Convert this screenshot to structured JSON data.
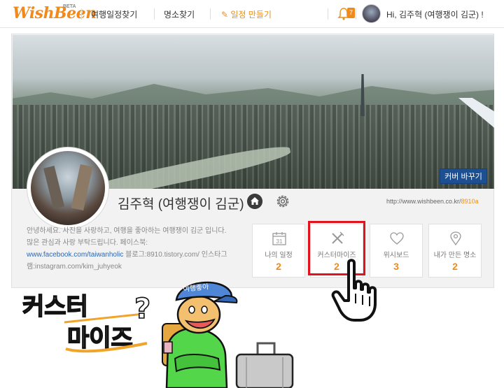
{
  "header": {
    "logo": "WishBeen",
    "beta": "BETA",
    "nav": [
      "여행일정찾기",
      "명소찾기",
      "✎ 일정 만들기"
    ],
    "notification_count": "7",
    "greeting": "Hi, 김주혁 (여행쟁이 김군) !"
  },
  "profile": {
    "cover_button": "커버 바꾸기",
    "name": "김주혁 (여행쟁이 김군)",
    "url_prefix": "http://www.wishbeen.co.kr/",
    "url_id": "8910a",
    "bio": [
      "안녕하세요. 사진을 사랑하고, 여행을 좋아하는 여행쟁이 김군 입니다.",
      "많은 관심과 사랑 부탁드립니다. 페이스북:",
      "www.facebook.com/taiwanholic",
      " 블로그:8910.tistory.com/ 인스타그",
      "램:instagram.com/kim_juhyeok"
    ]
  },
  "stats": [
    {
      "label": "나의 일정",
      "count": "2",
      "icon": "calendar-icon",
      "day": "31"
    },
    {
      "label": "커스터마이즈",
      "count": "2",
      "icon": "pencil-ruler-icon"
    },
    {
      "label": "위시보드",
      "count": "3",
      "icon": "heart-icon"
    },
    {
      "label": "내가 만든 명소",
      "count": "2",
      "icon": "map-pin-icon"
    }
  ],
  "drawing": {
    "line1": "커스터",
    "line2": "마이즈",
    "question": "?",
    "cap_text": "여행좋아"
  },
  "colors": {
    "brand": "#f08a1c",
    "cover_button": "#1d4f93",
    "highlight": "#e0141f",
    "link": "#2e67b0"
  }
}
